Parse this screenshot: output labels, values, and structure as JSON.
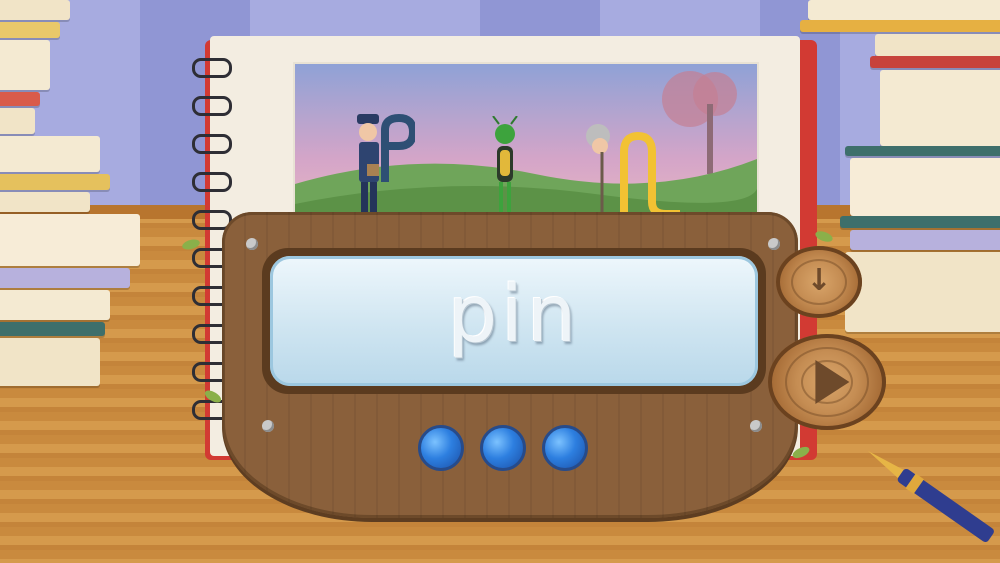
{
  "game": {
    "word": "pin",
    "progress_dots_total": 3,
    "progress_dots_filled": 3
  },
  "controls": {
    "down_icon": "arrow-down-icon",
    "play_icon": "play-icon"
  },
  "colors": {
    "panel_wood": "#8a603b",
    "screen_glass": "#cfe5f1",
    "dot_blue": "#2d7fe0",
    "notebook_red": "#d23a33",
    "desk": "#c98a3e"
  }
}
